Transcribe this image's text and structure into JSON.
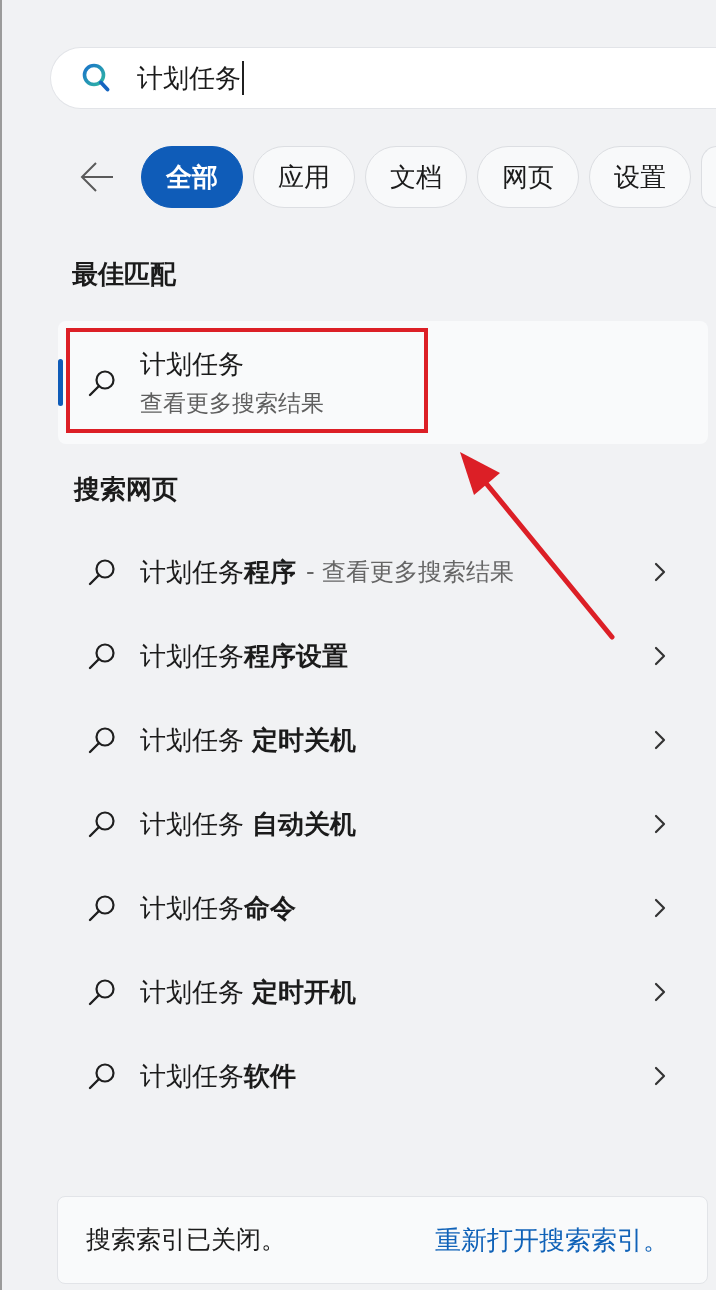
{
  "search": {
    "value": "计划任务"
  },
  "filters": [
    {
      "label": "全部",
      "selected": true
    },
    {
      "label": "应用",
      "selected": false
    },
    {
      "label": "文档",
      "selected": false
    },
    {
      "label": "网页",
      "selected": false
    },
    {
      "label": "设置",
      "selected": false
    }
  ],
  "best_match": {
    "heading": "最佳匹配",
    "item": {
      "title": "计划任务",
      "subtitle": "查看更多搜索结果",
      "selected": true
    }
  },
  "web_search": {
    "heading": "搜索网页",
    "items": [
      {
        "label": "计划任务**程序**",
        "hint": "- 查看更多搜索结果"
      },
      {
        "label": "计划任务**程序设置**"
      },
      {
        "label": "计划任务 **定时关机**"
      },
      {
        "label": "计划任务 **自动关机**"
      },
      {
        "label": "计划任务**命令**"
      },
      {
        "label": "计划任务 **定时开机**"
      },
      {
        "label": "计划任务**软件**"
      }
    ]
  },
  "footer": {
    "message": "搜索索引已关闭。",
    "link": "重新打开搜索索引。"
  }
}
